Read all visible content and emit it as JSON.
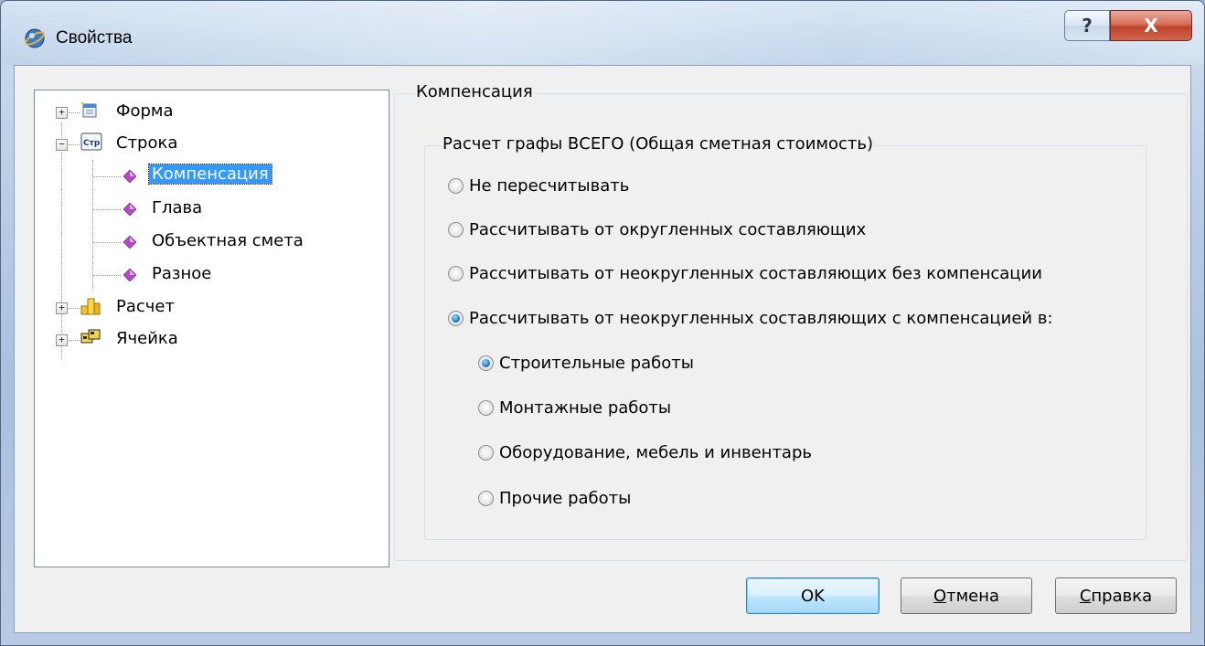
{
  "window": {
    "title": "Свойства",
    "help_glyph": "?",
    "close_glyph": "X"
  },
  "tree": {
    "items": [
      {
        "label": "Форма",
        "icon": "form-icon",
        "expander": "+"
      },
      {
        "label": "Строка",
        "icon": "string-icon",
        "expander": "−",
        "icon_text": "Стр"
      },
      {
        "label": "Компенсация",
        "icon": "gem-icon",
        "selected": true
      },
      {
        "label": "Глава",
        "icon": "gem-icon"
      },
      {
        "label": "Объектная смета",
        "icon": "gem-icon"
      },
      {
        "label": "Разное",
        "icon": "gem-icon"
      },
      {
        "label": "Расчет",
        "icon": "coins-icon",
        "expander": "+"
      },
      {
        "label": "Ячейка",
        "icon": "cell-icon",
        "expander": "+"
      }
    ]
  },
  "panel": {
    "group_title": "Компенсация",
    "inner_group_title": "Расчет графы ВСЕГО (Общая сметная стоимость)",
    "options": [
      {
        "label": "Не пересчитывать",
        "checked": false
      },
      {
        "label": "Рассчитывать от округленных составляющих",
        "checked": false
      },
      {
        "label": "Рассчитывать от неокругленных составляющих без компенсации",
        "checked": false
      },
      {
        "label": "Рассчитывать от неокругленных составляющих с компенсацией в:",
        "checked": true
      }
    ],
    "sub_options": [
      {
        "label": "Строительные работы",
        "checked": true
      },
      {
        "label": "Монтажные работы",
        "checked": false
      },
      {
        "label": "Оборудование, мебель и инвентарь",
        "checked": false
      },
      {
        "label": "Прочие работы",
        "checked": false
      }
    ]
  },
  "buttons": {
    "ok": "OK",
    "cancel_first": "О",
    "cancel_rest": "тмена",
    "help_first": "С",
    "help_rest": "правка"
  },
  "colors": {
    "selection": "#3399ff",
    "close_button": "#c1422b",
    "dialog_bg": "#f0f0f0"
  }
}
